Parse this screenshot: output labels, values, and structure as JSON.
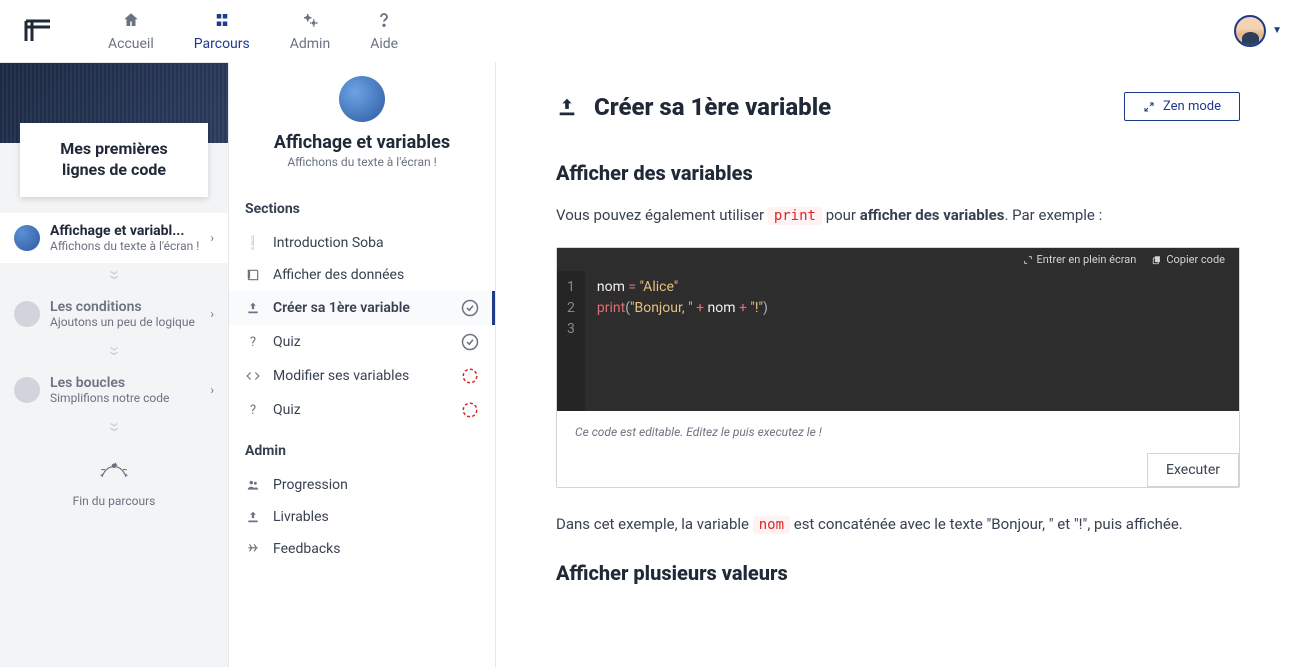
{
  "nav": {
    "home": "Accueil",
    "courses": "Parcours",
    "admin": "Admin",
    "help": "Aide"
  },
  "course": {
    "title": "Mes premières lignes de code",
    "end": "Fin du parcours"
  },
  "chapters": [
    {
      "title": "Affichage et variabl...",
      "sub": "Affichons du texte à l'écran !",
      "active": true,
      "icon": "blue"
    },
    {
      "title": "Les conditions",
      "sub": "Ajoutons un peu de logique",
      "active": false,
      "icon": "grey"
    },
    {
      "title": "Les boucles",
      "sub": "Simplifions notre code",
      "active": false,
      "icon": "grey"
    }
  ],
  "detail": {
    "title": "Affichage et variables",
    "sub": "Affichons du texte à l'écran !",
    "sections_label": "Sections",
    "admin_label": "Admin",
    "sections": [
      {
        "icon": "info",
        "label": "Introduction Soba",
        "status": "none"
      },
      {
        "icon": "book",
        "label": "Afficher des données",
        "status": "none"
      },
      {
        "icon": "upload",
        "label": "Créer sa 1ère variable",
        "status": "done",
        "active": true
      },
      {
        "icon": "question",
        "label": "Quiz",
        "status": "done"
      },
      {
        "icon": "code",
        "label": "Modifier ses variables",
        "status": "pending"
      },
      {
        "icon": "question",
        "label": "Quiz",
        "status": "pending"
      }
    ],
    "admin_items": [
      {
        "icon": "people",
        "label": "Progression"
      },
      {
        "icon": "upload",
        "label": "Livrables"
      },
      {
        "icon": "feedback",
        "label": "Feedbacks"
      }
    ]
  },
  "content": {
    "page_title": "Créer sa 1ère variable",
    "zen": "Zen mode",
    "h2_1": "Afficher des variables",
    "p1_pre": "Vous pouvez également utiliser ",
    "p1_code": "print",
    "p1_mid": " pour ",
    "p1_bold": "afficher des variables",
    "p1_post": ". Par exemple :",
    "code": {
      "fullscreen": "Entrer en plein écran",
      "copy": "Copier code",
      "lines": [
        "1",
        "2",
        "3"
      ],
      "l1": {
        "var": "nom",
        "op": " = ",
        "str": "\"Alice\""
      },
      "l2": {
        "fn": "print",
        "open": "(",
        "s1": "\"Bonjour, \"",
        "op1": " + ",
        "v": "nom",
        "op2": " + ",
        "s2": "\"!\"",
        "close": ")"
      },
      "hint": "Ce code est editable. Editez le puis executez le !",
      "exec": "Executer"
    },
    "p2_pre": "Dans cet exemple, la variable ",
    "p2_code": "nom",
    "p2_post": " est concaténée avec le texte \"Bonjour, \" et \"!\", puis affichée.",
    "h2_2": "Afficher plusieurs valeurs"
  }
}
